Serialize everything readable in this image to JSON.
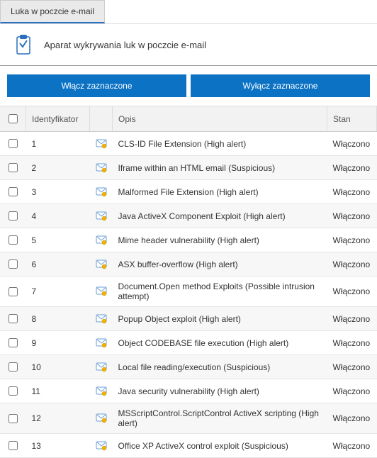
{
  "tab": {
    "label": "Luka w poczcie e-mail"
  },
  "header": {
    "title": "Aparat wykrywania luk w poczcie e-mail"
  },
  "buttons": {
    "enable": "Włącz zaznaczone",
    "disable": "Wyłącz zaznaczone"
  },
  "columns": {
    "id": "Identyfikator",
    "desc": "Opis",
    "status": "Stan"
  },
  "rows": [
    {
      "id": "1",
      "desc": "CLS-ID File Extension (High alert)",
      "status": "Włączono"
    },
    {
      "id": "2",
      "desc": "Iframe within an HTML email (Suspicious)",
      "status": "Włączono"
    },
    {
      "id": "3",
      "desc": "Malformed File Extension (High alert)",
      "status": "Włączono"
    },
    {
      "id": "4",
      "desc": "Java ActiveX Component Exploit (High alert)",
      "status": "Włączono"
    },
    {
      "id": "5",
      "desc": "Mime header vulnerability (High alert)",
      "status": "Włączono"
    },
    {
      "id": "6",
      "desc": "ASX buffer-overflow (High alert)",
      "status": "Włączono"
    },
    {
      "id": "7",
      "desc": "Document.Open method Exploits (Possible intrusion attempt)",
      "status": "Włączono"
    },
    {
      "id": "8",
      "desc": "Popup Object exploit (High alert)",
      "status": "Włączono"
    },
    {
      "id": "9",
      "desc": "Object CODEBASE file execution (High alert)",
      "status": "Włączono"
    },
    {
      "id": "10",
      "desc": "Local file reading/execution (Suspicious)",
      "status": "Włączono"
    },
    {
      "id": "11",
      "desc": "Java security vulnerability (High alert)",
      "status": "Włączono"
    },
    {
      "id": "12",
      "desc": "MSScriptControl.ScriptControl ActiveX scripting (High alert)",
      "status": "Włączono"
    },
    {
      "id": "13",
      "desc": "Office XP ActiveX control exploit (Suspicious)",
      "status": "Włączono"
    }
  ]
}
